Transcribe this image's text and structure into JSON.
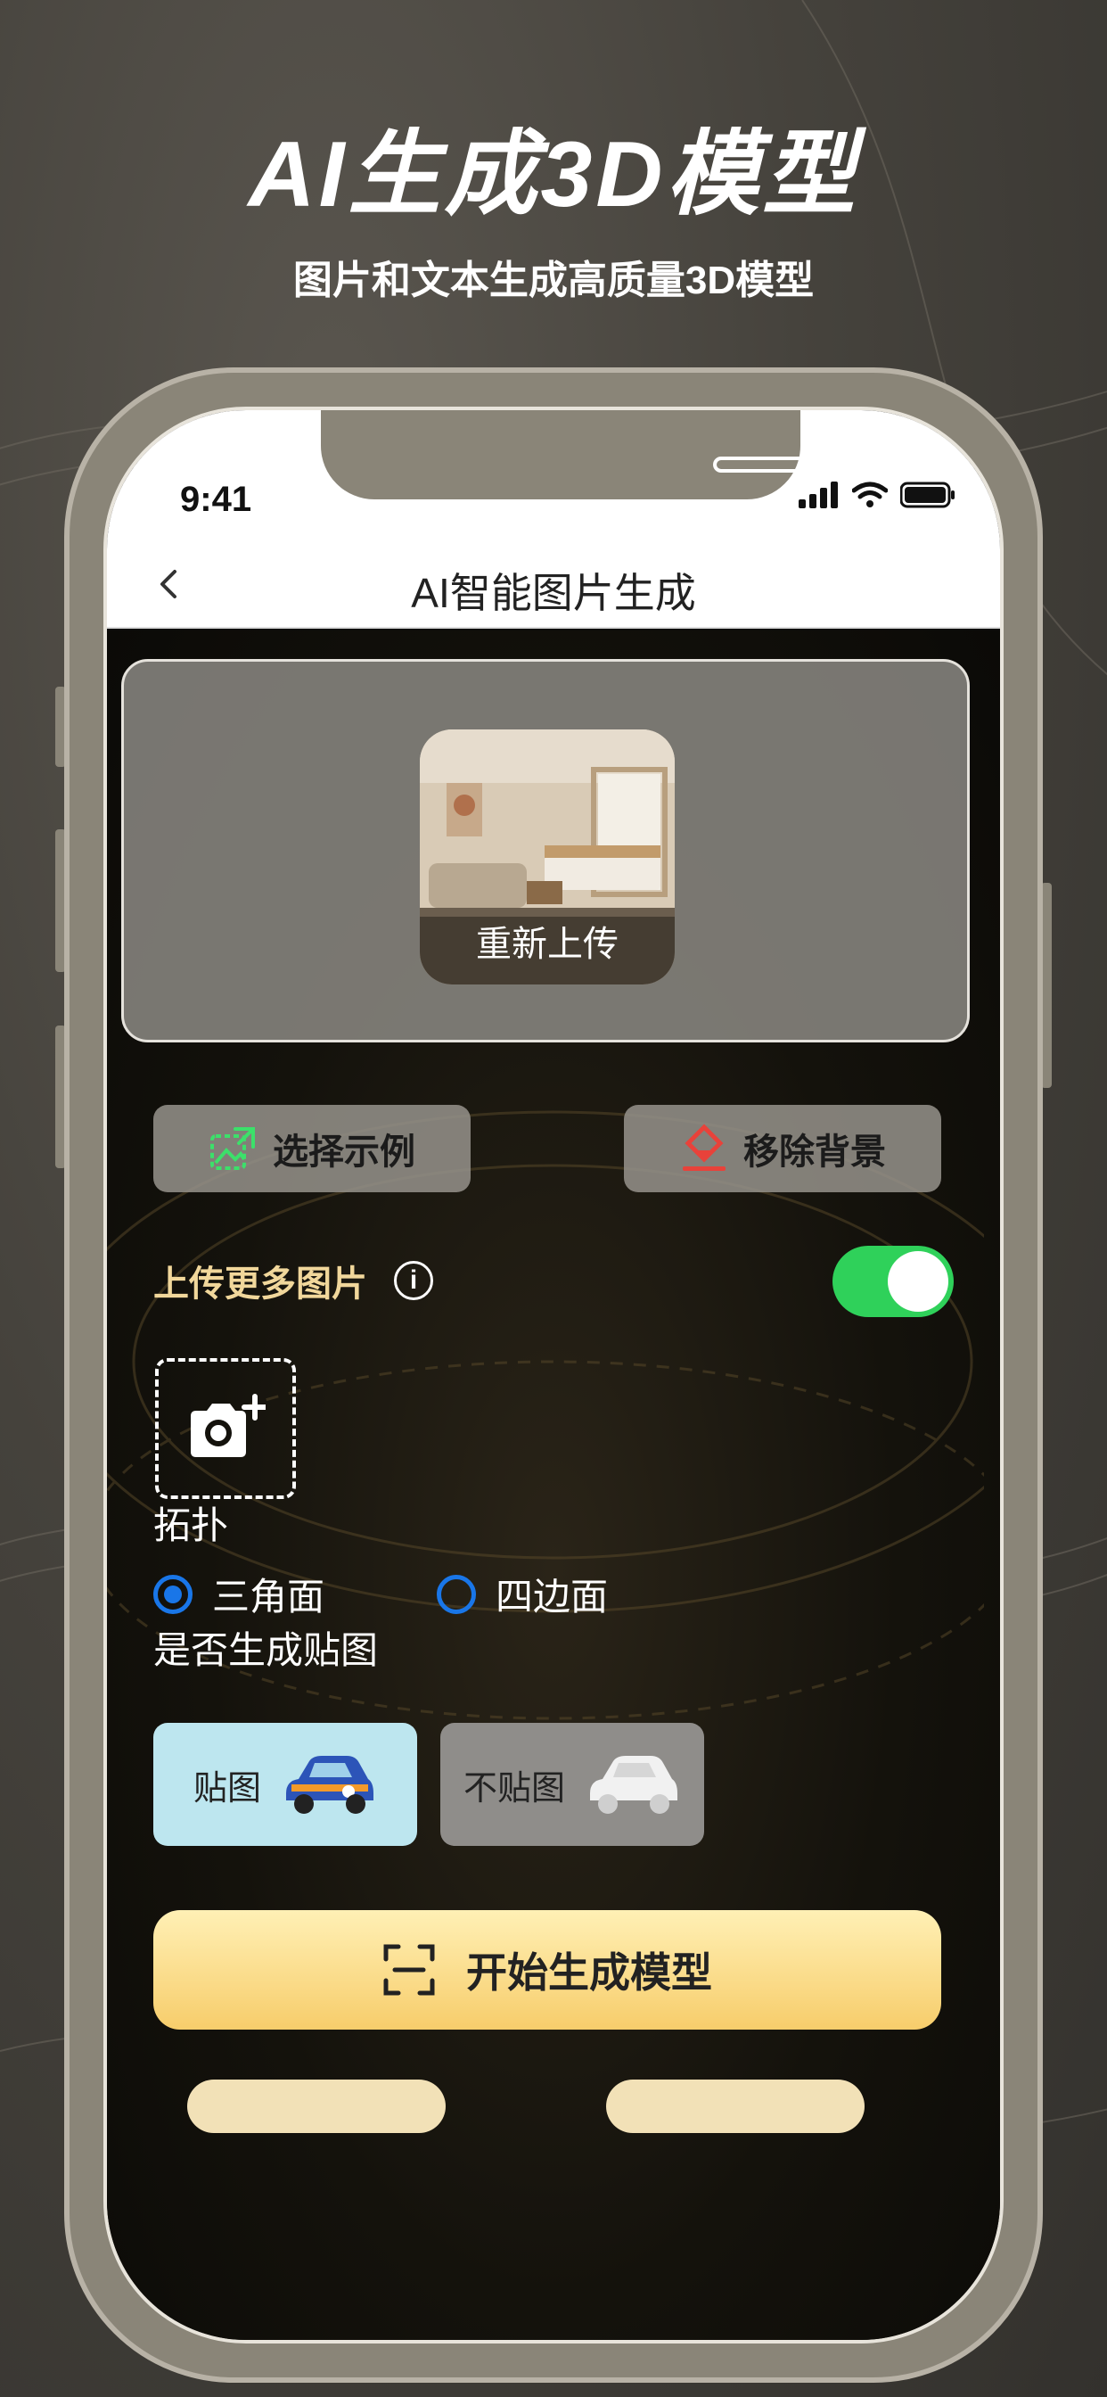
{
  "hero": {
    "title": "AI生成3D模型",
    "subtitle": "图片和文本生成高质量3D模型"
  },
  "status_bar": {
    "time": "9:41"
  },
  "navbar": {
    "title": "AI智能图片生成",
    "back_icon": "chevron-left-icon"
  },
  "upload": {
    "reupload_label": "重新上传"
  },
  "actions": {
    "select_example": "选择示例",
    "remove_background": "移除背景"
  },
  "more_images": {
    "label": "上传更多图片",
    "info_icon": "i",
    "toggle_on": true
  },
  "topology": {
    "label": "拓扑",
    "options": [
      {
        "label": "三角面",
        "selected": true
      },
      {
        "label": "四边面",
        "selected": false
      }
    ]
  },
  "texture": {
    "label": "是否生成贴图",
    "options": [
      {
        "label": "贴图",
        "selected": true
      },
      {
        "label": "不贴图",
        "selected": false
      }
    ]
  },
  "generate_button": {
    "label": "开始生成模型"
  },
  "colors": {
    "accent_gold": "#f7cd6b",
    "toggle_green": "#2fd15a",
    "radio_blue": "#1976e8",
    "label_gold": "#f1d79b",
    "texture_selected_bg": "#bde6ef",
    "texture_unselected_bg": "#8f8d8a"
  }
}
